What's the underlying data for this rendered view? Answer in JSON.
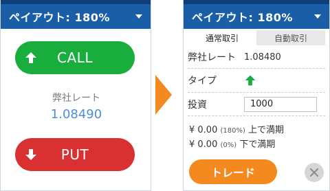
{
  "left_panel": {
    "header_title": "ペイアウト: 180%",
    "call_label": "CALL",
    "rate_label": "弊社レート",
    "rate_value": "1.08490",
    "put_label": "PUT"
  },
  "right_panel": {
    "header_title": "ペイアウト: 180%",
    "tabs": [
      {
        "label": "通常取引",
        "active": true
      },
      {
        "label": "自動取引",
        "active": false
      }
    ],
    "rate_label": "弊社レート",
    "rate_value": "1.08480",
    "type_label": "タイプ",
    "invest_label": "投資",
    "invest_value": "1000",
    "payout_up": {
      "amount": "¥ 0.00",
      "pct": "(180%)",
      "text": "上で満期"
    },
    "payout_down": {
      "amount": "¥ 0.00",
      "pct": "(0%)",
      "text": "下で満期"
    },
    "trade_label": "トレード"
  },
  "icons": {
    "call_arrow": "arrow-up-icon",
    "put_arrow": "arrow-down-icon",
    "type_arrow": "arrow-up-icon",
    "flow": "chevron-right-icon",
    "close": "close-icon",
    "dropdown": "caret-down-icon"
  },
  "colors": {
    "header": "#1a5ea8",
    "call": "#18ad3d",
    "put": "#d93131",
    "trade": "#f4891f",
    "rate_value": "#4a8fd6"
  }
}
